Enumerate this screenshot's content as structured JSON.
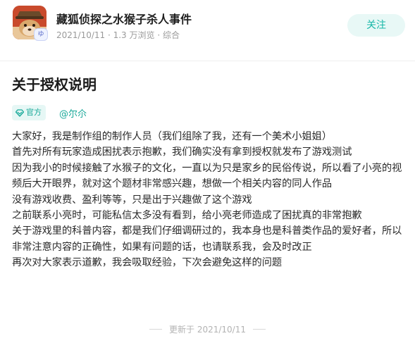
{
  "header": {
    "game_title": "藏狐侦探之水猴子杀人事件",
    "meta": "2021/10/11 · 1.3 万浏览 · 综合",
    "follow_label": "关注",
    "avatar_badge": "ゆ"
  },
  "article": {
    "title": "关于授权说明",
    "official_badge": "官方",
    "author": "@尔尒",
    "paragraphs": [
      "大家好，我是制作组的制作人员（我们组除了我，还有一个美术小姐姐）",
      "首先对所有玩家造成困扰表示抱歉，我们确实没有拿到授权就发布了游戏测试",
      "因为我小的时候接触了水猴子的文化，一直以为只是家乡的民俗传说，所以看了小亮的视频后大开眼界，就对这个题材非常感兴趣，想做一个相关内容的同人作品",
      "没有游戏收费、盈利等等，只是出于兴趣做了这个游戏",
      "之前联系小亮时，可能私信太多没有看到，给小亮老师造成了困扰真的非常抱歉",
      "关于游戏里的科普内容，都是我们仔细调研过的，我本身也是科普类作品的爱好者，所以非常注意内容的正确性，如果有问题的话，也请联系我，会及时改正",
      "再次对大家表示道歉，我会吸取经验，下次会避免这样的问题"
    ],
    "updated": "更新于 2021/10/11"
  },
  "colors": {
    "accent": "#18b7a8",
    "accent_bg": "#e8f8f6"
  }
}
